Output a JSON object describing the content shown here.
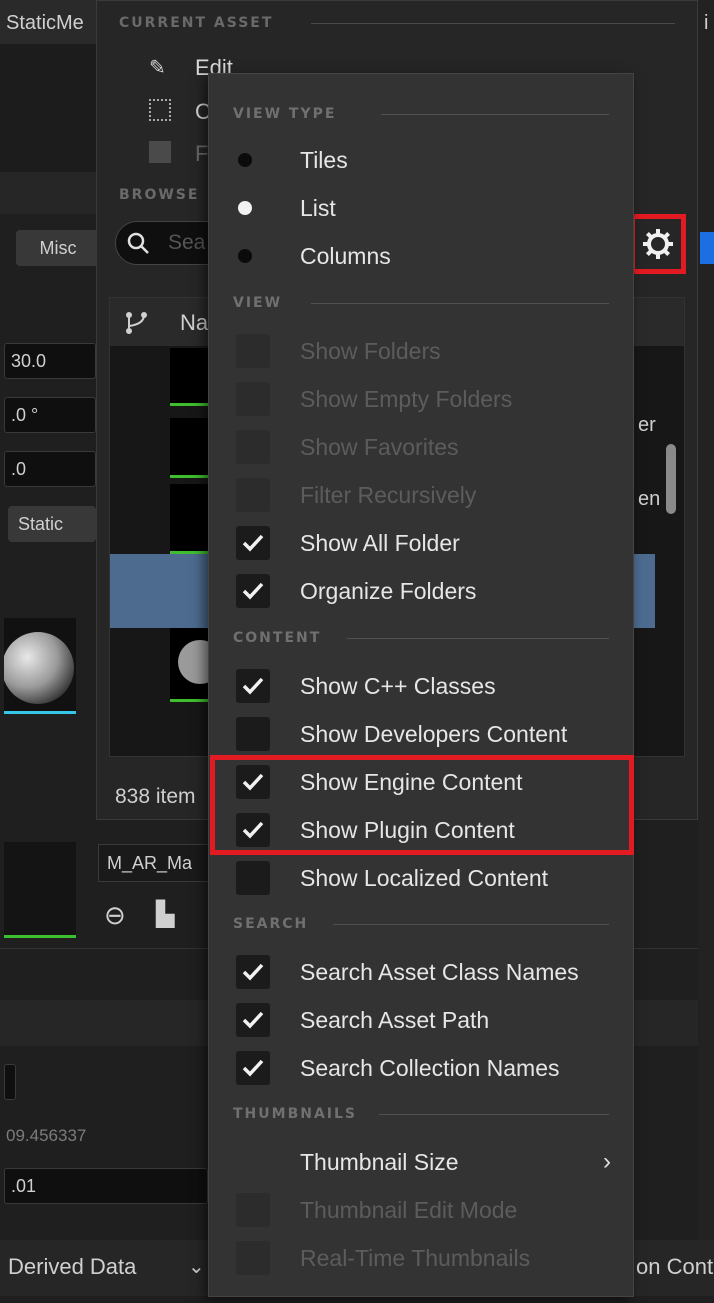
{
  "background": {
    "header_text": "StaticMe",
    "misc_button": "Misc",
    "fields": [
      "30.0",
      ".0 °",
      ".0"
    ],
    "static_label": "Static",
    "value_1": "09.456337",
    "value_2": ".01",
    "derived_data": "Derived Data",
    "bottom_right": "on Cont",
    "right_fragments": [
      "er",
      "en"
    ],
    "top_right_char": "i"
  },
  "content_browser": {
    "current_asset_label": "CURRENT ASSET",
    "edit_label": "Edit",
    "copy_label": "C",
    "find_label": "F",
    "browse_label": "BROWSE",
    "search_placeholder": "Sea",
    "column_name": "Na",
    "item_count": "838 item",
    "asset_name": "M_AR_Ma"
  },
  "menu": {
    "sections": {
      "view_type": "VIEW TYPE",
      "view": "VIEW",
      "content": "CONTENT",
      "search": "SEARCH",
      "thumbnails": "THUMBNAILS"
    },
    "view_type_items": [
      {
        "label": "Tiles",
        "selected": false
      },
      {
        "label": "List",
        "selected": true
      },
      {
        "label": "Columns",
        "selected": false
      }
    ],
    "view_items": [
      {
        "label": "Show Folders",
        "checked": false,
        "enabled": false
      },
      {
        "label": "Show Empty Folders",
        "checked": false,
        "enabled": false
      },
      {
        "label": "Show Favorites",
        "checked": false,
        "enabled": false
      },
      {
        "label": "Filter Recursively",
        "checked": false,
        "enabled": false
      },
      {
        "label": "Show All Folder",
        "checked": true,
        "enabled": true
      },
      {
        "label": "Organize Folders",
        "checked": true,
        "enabled": true
      }
    ],
    "content_items": [
      {
        "label": "Show C++ Classes",
        "checked": true,
        "enabled": true
      },
      {
        "label": "Show Developers Content",
        "checked": false,
        "enabled": true
      },
      {
        "label": "Show Engine Content",
        "checked": true,
        "enabled": true
      },
      {
        "label": "Show Plugin Content",
        "checked": true,
        "enabled": true
      },
      {
        "label": "Show Localized Content",
        "checked": false,
        "enabled": true
      }
    ],
    "search_items": [
      {
        "label": "Search Asset Class Names",
        "checked": true,
        "enabled": true
      },
      {
        "label": "Search Asset Path",
        "checked": true,
        "enabled": true
      },
      {
        "label": "Search Collection Names",
        "checked": true,
        "enabled": true
      }
    ],
    "thumbnail_items": [
      {
        "label": "Thumbnail Size",
        "type": "submenu"
      },
      {
        "label": "Thumbnail Edit Mode",
        "checked": false,
        "enabled": false
      },
      {
        "label": "Real-Time Thumbnails",
        "checked": false,
        "enabled": false
      }
    ]
  },
  "colors": {
    "highlight": "#e21a22",
    "accent_green": "#3fbf2f",
    "accent_cyan": "#37c6e6",
    "selection_blue": "#4d6b8f",
    "menu_bg": "#333333"
  }
}
